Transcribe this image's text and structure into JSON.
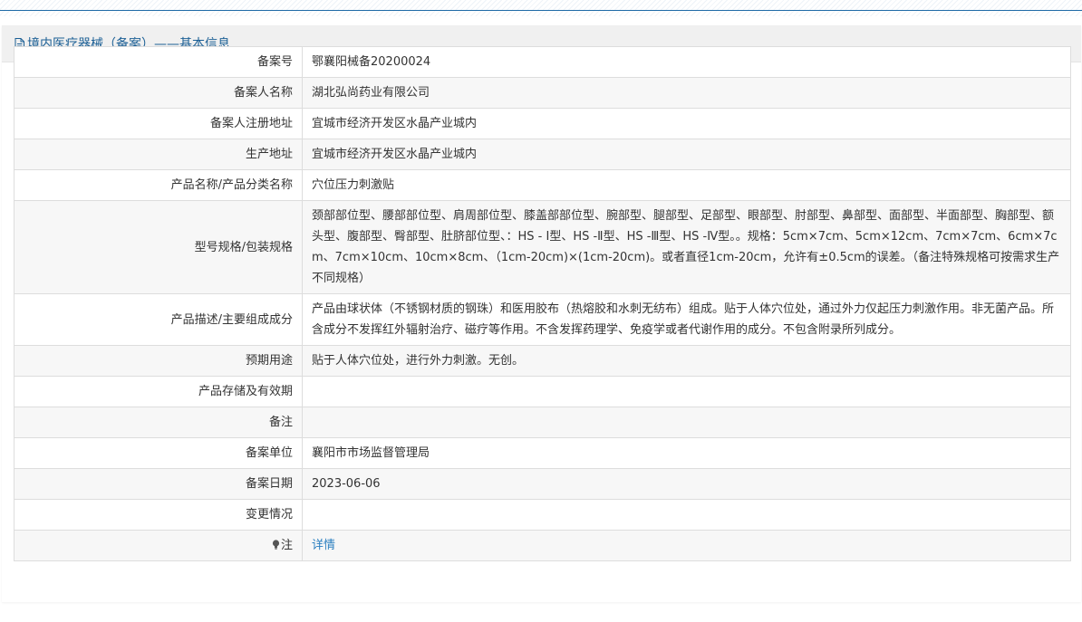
{
  "header": {
    "title": "境内医疗器械（备案）——基本信息"
  },
  "icons": {
    "header_icon": "document-icon",
    "note_icon": "lightbulb-icon"
  },
  "colors": {
    "title": "#1b5f95",
    "link": "#2b7fc0",
    "top_border": "#1e6aa6"
  },
  "rows": [
    {
      "label": "备案号",
      "value": "鄂襄阳械备20200024"
    },
    {
      "label": "备案人名称",
      "value": "湖北弘尚药业有限公司"
    },
    {
      "label": "备案人注册地址",
      "value": "宜城市经济开发区水晶产业城内"
    },
    {
      "label": "生产地址",
      "value": "宜城市经济开发区水晶产业城内"
    },
    {
      "label": "产品名称/产品分类名称",
      "value": "穴位压力刺激贴"
    },
    {
      "label": "型号规格/包装规格",
      "value": "颈部部位型、腰部部位型、肩周部位型、膝盖部部位型、腕部型、腿部型、足部型、眼部型、肘部型、鼻部型、面部型、半面部型、胸部型、额头型、腹部型、臀部型、肚脐部位型、：HS - Ⅰ型、HS -Ⅱ型、HS -Ⅲ型、HS -Ⅳ型。。规格：5cm×7cm、5cm×12cm、7cm×7cm、6cm×7cm、7cm×10cm、10cm×8cm、（1cm-20cm)×(1cm-20cm)。或者直径1cm-20cm，允许有±0.5cm的误差。（备注特殊规格可按需求生产不同规格）"
    },
    {
      "label": "产品描述/主要组成成分",
      "value": "产品由球状体（不锈钢材质的钢珠）和医用胶布（热熔胶和水刺无纺布）组成。贴于人体穴位处，通过外力仅起压力刺激作用。非无菌产品。所含成分不发挥红外辐射治疗、磁疗等作用。不含发挥药理学、免疫学或者代谢作用的成分。不包含附录所列成分。"
    },
    {
      "label": "预期用途",
      "value": "贴于人体穴位处，进行外力刺激。无创。"
    },
    {
      "label": "产品存储及有效期",
      "value": ""
    },
    {
      "label": "备注",
      "value": ""
    },
    {
      "label": "备案单位",
      "value": "襄阳市市场监督管理局"
    },
    {
      "label": "备案日期",
      "value": "2023-06-06"
    },
    {
      "label": "变更情况",
      "value": ""
    },
    {
      "label": "注",
      "value": "详情"
    }
  ]
}
